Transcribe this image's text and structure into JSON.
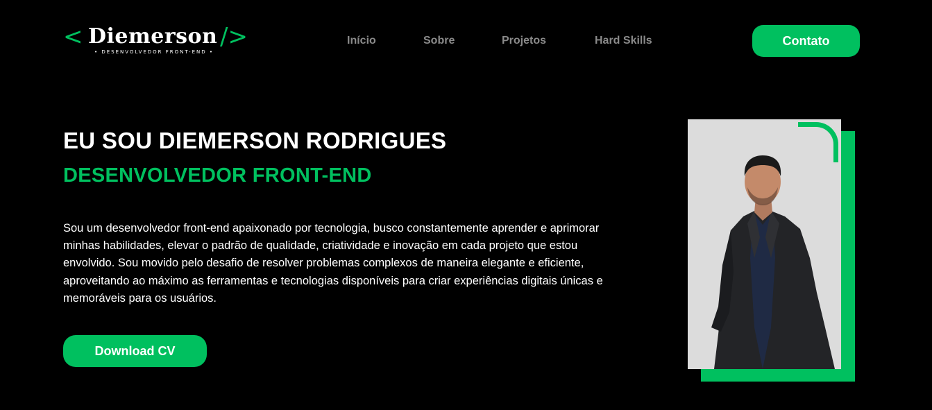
{
  "logo": {
    "open_bracket": "<",
    "name": "Diemerson",
    "close_bracket": "/>",
    "subtitle": "• DESENVOLVEDOR FRONT-END •"
  },
  "nav": {
    "items": [
      {
        "label": "Início"
      },
      {
        "label": "Sobre"
      },
      {
        "label": "Projetos"
      },
      {
        "label": "Hard Skills"
      }
    ]
  },
  "header": {
    "contact_label": "Contato"
  },
  "hero": {
    "title": "EU SOU DIEMERSON RODRIGUES",
    "subtitle": "DESENVOLVEDOR FRONT-END",
    "description": "Sou um desenvolvedor front-end apaixonado por tecnologia, busco constantemente aprender e aprimorar minhas habilidades, elevar o padrão de qualidade, criatividade e inovação em cada projeto que estou envolvido. Sou movido pelo desafio de resolver problemas complexos de maneira elegante e eficiente, aproveitando ao máximo as ferramentas e tecnologias disponíveis para criar experiências digitais únicas e memoráveis para os usuários.",
    "download_label": "Download CV"
  },
  "colors": {
    "accent": "#00c05f",
    "background": "#000000",
    "nav_text": "#8a8a8a",
    "photo_background": "#dcdcdc"
  }
}
